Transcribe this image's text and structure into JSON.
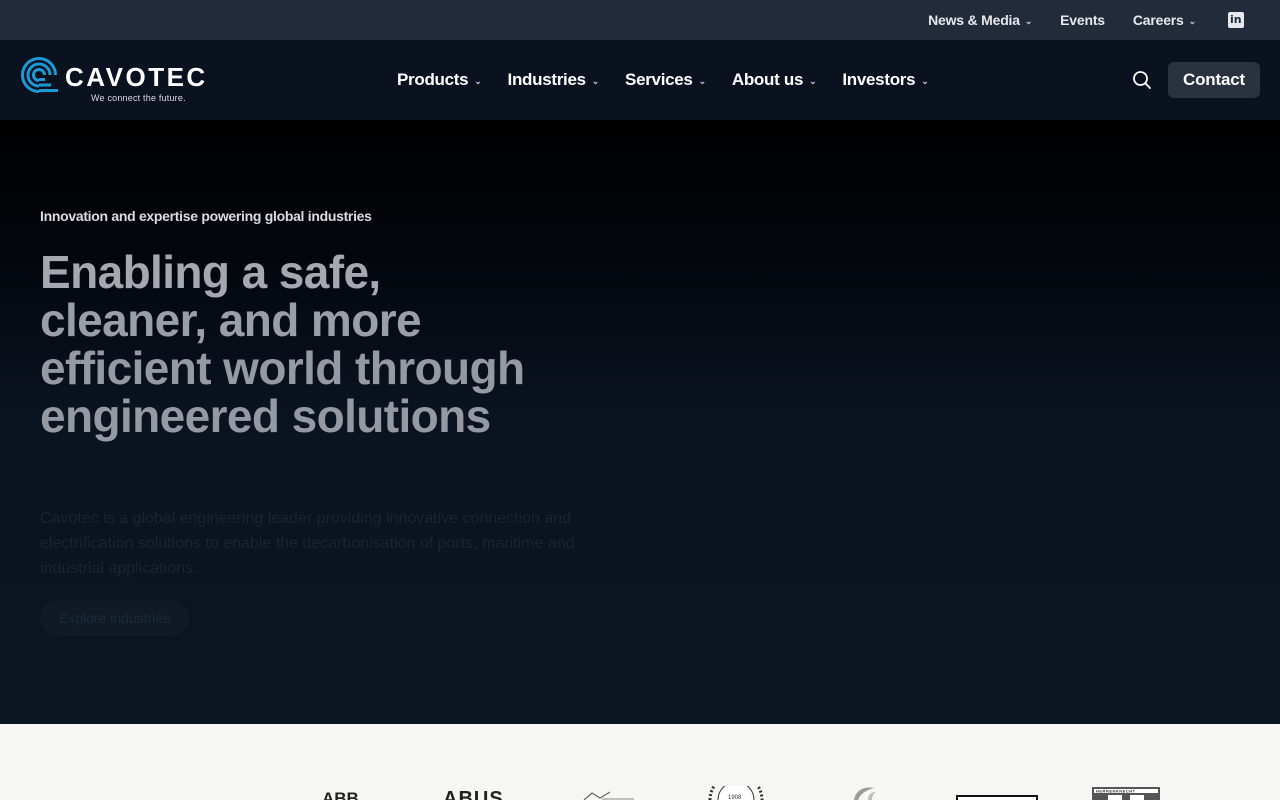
{
  "topbar": {
    "items": [
      {
        "label": "News & Media",
        "has_dropdown": true
      },
      {
        "label": "Events",
        "has_dropdown": false
      },
      {
        "label": "Careers",
        "has_dropdown": true
      }
    ],
    "social_icon": "linkedin-icon"
  },
  "header": {
    "brand": "CAVOTEC",
    "tagline": "We connect the future.",
    "menu": [
      {
        "label": "Products"
      },
      {
        "label": "Industries"
      },
      {
        "label": "Services"
      },
      {
        "label": "About us"
      },
      {
        "label": "Investors"
      }
    ],
    "search_icon": "search-icon",
    "contact_label": "Contact"
  },
  "hero": {
    "eyebrow": "Innovation and expertise powering global industries",
    "headline_lines": [
      "Enabling a safe,",
      "cleaner, and more",
      "efficient world through",
      "engineered solutions"
    ],
    "description": "Cavotec is a global engineering leader providing innovative connection and electrification solutions to enable the decarbonisation of ports, maritime and industrial applications.",
    "cta_label": "Explore industries"
  },
  "partners": {
    "logos": [
      "ABB",
      "ABUS",
      "partner-logo-3",
      "partner-logo-4",
      "partner-logo-5",
      "partner-logo-6",
      "HERRENKNECHT"
    ]
  },
  "colors": {
    "topbar_bg": "#222b39",
    "nav_bg": "#0a1220",
    "accent_blue": "#1a9ad6",
    "contact_bg": "#2a323f",
    "page_bg": "#f6f6f2"
  }
}
